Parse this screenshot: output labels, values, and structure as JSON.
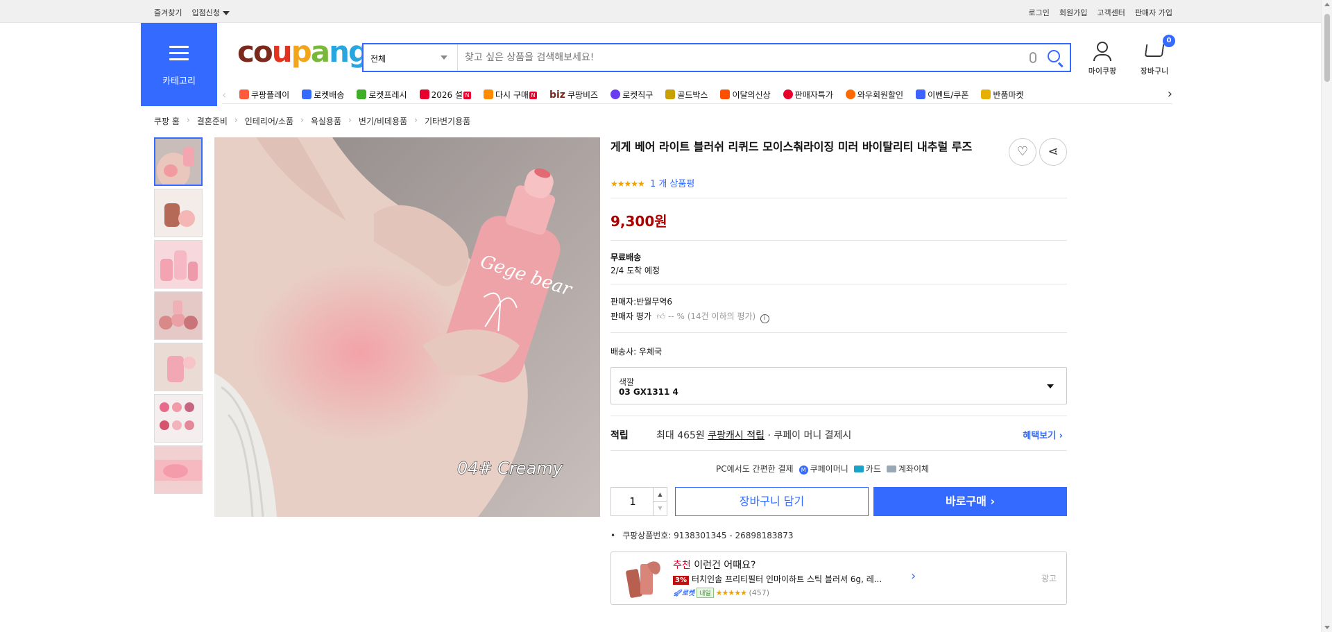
{
  "topbar": {
    "left": [
      "즐겨찾기",
      "입점신청"
    ],
    "right": [
      "로그인",
      "회원가입",
      "고객센터",
      "판매자 가입"
    ]
  },
  "header": {
    "category_label": "카테고리",
    "logo_text": "coupang",
    "search_category": "전체",
    "search_placeholder": "찾고 싶은 상품을 검색해보세요!",
    "mycoupang_label": "마이쿠팡",
    "cart_label": "장바구니",
    "cart_count": "0"
  },
  "nav": {
    "items": [
      "쿠팡플레이",
      "로켓배송",
      "로켓프레시",
      "2026 설",
      "다시 구매",
      "쿠팡비즈",
      "로켓직구",
      "골드박스",
      "이달의신상",
      "판매자특가",
      "와우회원할인",
      "이벤트/쿠폰",
      "반품마켓"
    ],
    "biz_prefix": "biz",
    "new_badge": "N",
    "icon_colors": [
      "#ff5a3c",
      "#346aff",
      "#3fae29",
      "#e8002d",
      "#ff8a00",
      "#6a3cf0",
      "#c8a000",
      "#ff4f00",
      "#e8002d",
      "#ff6a00",
      "#3c63ff",
      "#e6b000"
    ]
  },
  "breadcrumb": [
    "쿠팡 홈",
    "결혼준비",
    "인테리어/소품",
    "욕실용품",
    "변기/비데용품",
    "기타변기용품"
  ],
  "product": {
    "title": "게게 베어 라이트 블러쉬 리퀴드 모이스춰라이징 미러 바이탈리티 내추럴 루즈",
    "rating_stars": "★★★★★",
    "review_text": "1 개 상품평",
    "price": "9,300원",
    "shipping_label": "무료배송",
    "arrival": "2/4 도착 예정",
    "seller": "판매자:반월무역6",
    "seller_rating_label": "판매자 평가",
    "seller_rating_value": "-- % (14건 이하의 평가)",
    "carrier": "배송사:  우체국",
    "option_label": "색깔",
    "option_value": "03 GX1311 4",
    "reward_label": "적립",
    "reward_prefix": "최대 465원",
    "reward_link": "쿠팡캐시 적립",
    "reward_suffix": "· 쿠페이 머니 결제시",
    "reward_more": "혜택보기",
    "pay_intro": "PC에서도 간편한 결제",
    "pay_money": "쿠페이머니",
    "pay_card": "카드",
    "pay_bank": "계좌이체",
    "quantity": "1",
    "add_to_cart": "장바구니 담기",
    "buy_now": "바로구매",
    "product_number": "쿠팡상품번호: 9138301345 - 26898183873",
    "image_caption": "04# Creamy",
    "bottle_text": "Gege bear"
  },
  "recommend": {
    "heading_red": "추천",
    "heading": "이런건 어때요?",
    "discount": "3%",
    "name": "터치인솔 프리티필터 인마이하트 스틱 블러셔 6g, 레...",
    "rocket": "로켓",
    "next_day": "내일",
    "stars": "★★★★★",
    "reviews": "(457)",
    "ad": "광고"
  },
  "colors": {
    "accent": "#346aff",
    "price": "#ae0000"
  }
}
